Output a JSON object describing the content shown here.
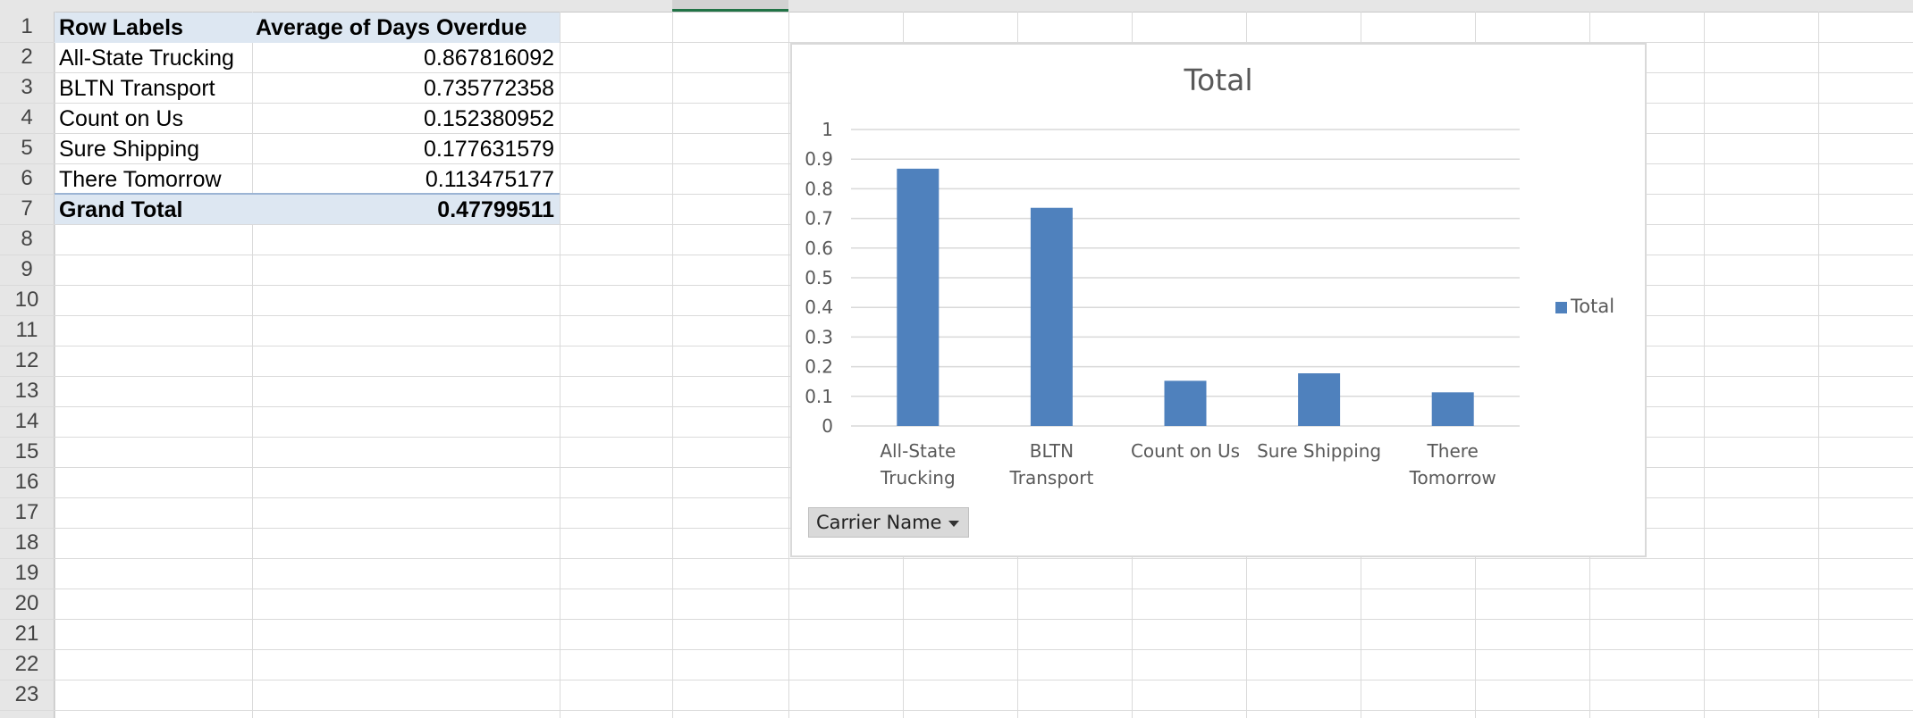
{
  "rows": [
    "1",
    "2",
    "3",
    "4",
    "5",
    "6",
    "7",
    "8",
    "9",
    "10",
    "11",
    "12",
    "13",
    "14",
    "15",
    "16",
    "17",
    "18",
    "19",
    "20",
    "21",
    "22",
    "23"
  ],
  "pivot": {
    "header_label": "Row Labels",
    "header_value": "Average of Days Overdue",
    "items": [
      {
        "label": "All-State Trucking",
        "value": "0.867816092"
      },
      {
        "label": "BLTN Transport",
        "value": "0.735772358"
      },
      {
        "label": "Count on Us",
        "value": "0.152380952"
      },
      {
        "label": "Sure Shipping",
        "value": "0.177631579"
      },
      {
        "label": "There Tomorrow",
        "value": "0.113475177"
      }
    ],
    "total_label": "Grand Total",
    "total_value": "0.47799511"
  },
  "chart_data": {
    "type": "bar",
    "title": "Total",
    "categories": [
      "All-State Trucking",
      "BLTN Transport",
      "Count on Us",
      "Sure Shipping",
      "There Tomorrow"
    ],
    "category_lines": [
      [
        "All-State",
        "Trucking"
      ],
      [
        "BLTN",
        "Transport"
      ],
      [
        "Count on Us"
      ],
      [
        "Sure Shipping"
      ],
      [
        "There",
        "Tomorrow"
      ]
    ],
    "series": [
      {
        "name": "Total",
        "values": [
          0.867816092,
          0.735772358,
          0.152380952,
          0.177631579,
          0.113475177
        ],
        "color": "#4f81bd"
      }
    ],
    "ylim": [
      0,
      1
    ],
    "yticks": [
      "0",
      "0.1",
      "0.2",
      "0.3",
      "0.4",
      "0.5",
      "0.6",
      "0.7",
      "0.8",
      "0.9",
      "1"
    ],
    "grid": true,
    "legend": "right",
    "xlabel": "",
    "ylabel": ""
  },
  "field_button": {
    "label": "Carrier Name"
  }
}
